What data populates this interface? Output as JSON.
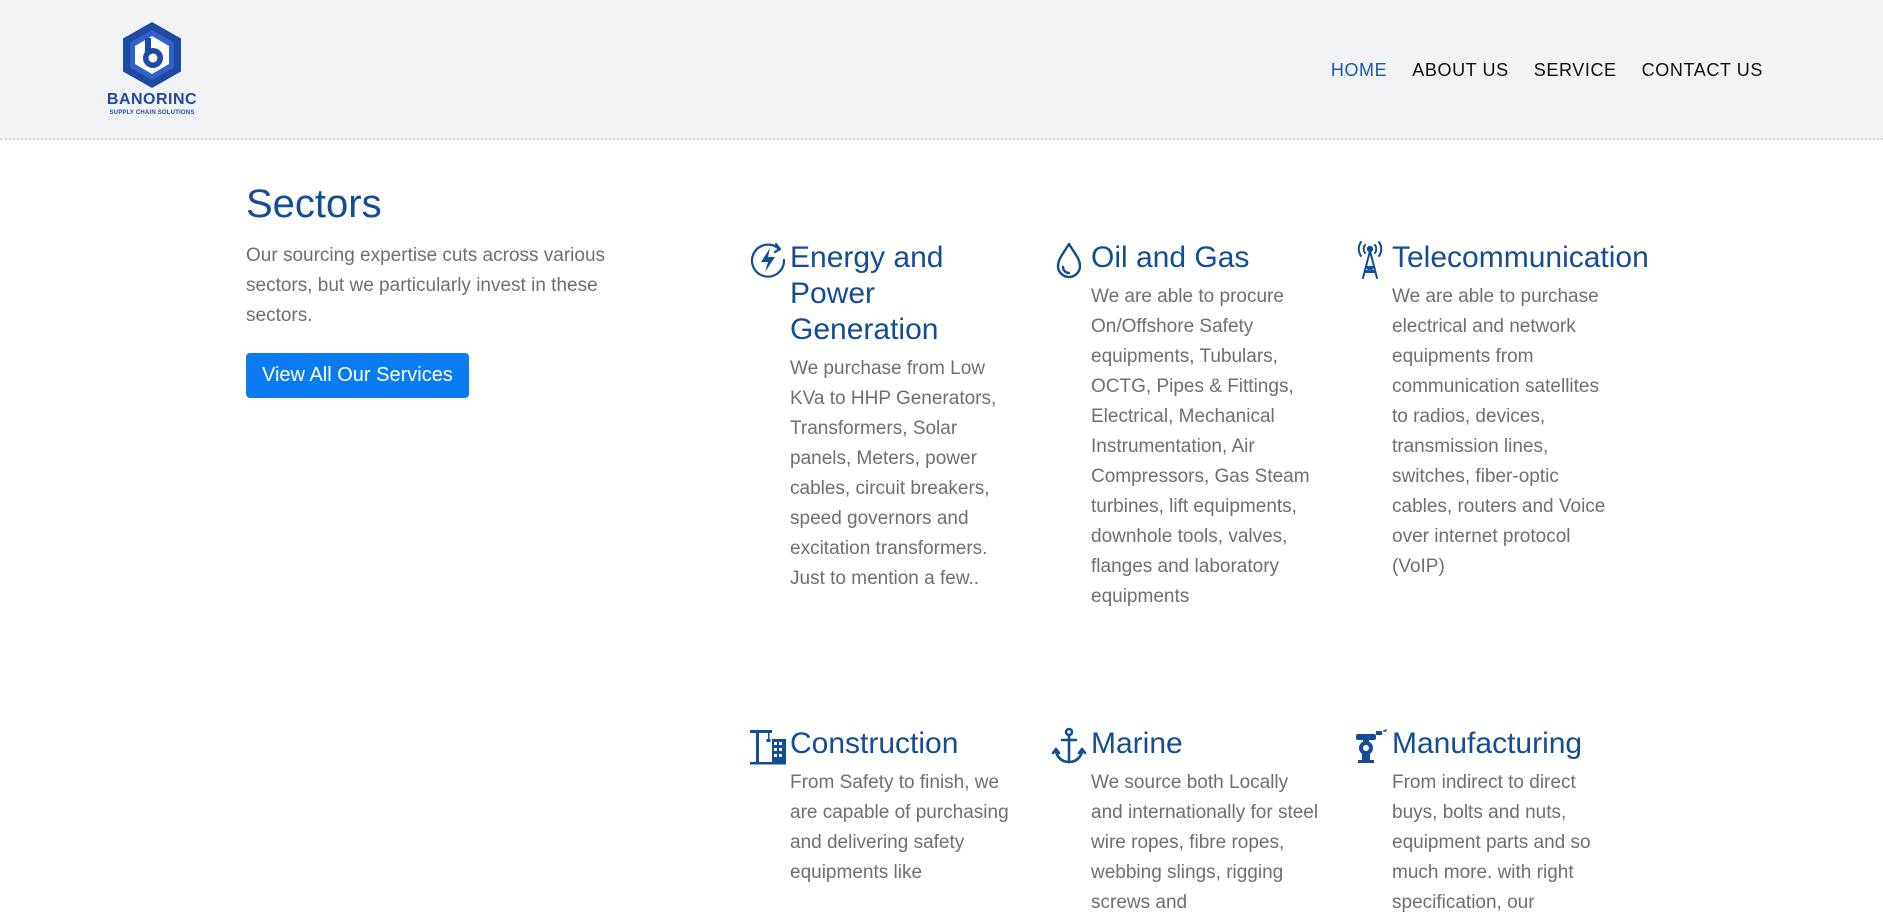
{
  "brand": {
    "name": "BANORINC",
    "tagline": "SUPPLY CHAIN SOLUTIONS"
  },
  "nav": {
    "items": [
      {
        "label": "HOME",
        "active": true
      },
      {
        "label": "ABOUT US",
        "active": false
      },
      {
        "label": "SERVICE",
        "active": false
      },
      {
        "label": "CONTACT US",
        "active": false
      }
    ]
  },
  "intro": {
    "title": "Sectors",
    "text": "Our sourcing expertise cuts across various sectors, but we particularly invest in these sectors.",
    "button_label": "View All Our Services"
  },
  "sectors": [
    {
      "icon": "power-icon",
      "title": "Energy and Power Generation",
      "text": "We purchase from Low KVa to HHP Generators, Transformers, Solar panels, Meters, power cables, circuit breakers, speed governors and excitation transformers. Just to mention a few.."
    },
    {
      "icon": "oil-drop-icon",
      "title": "Oil and Gas",
      "text": "We are able to procure On/Offshore Safety equipments, Tubulars, OCTG, Pipes & Fittings, Electrical, Mechanical Instrumentation, Air Compressors, Gas Steam turbines, lift equipments, downhole tools, valves, flanges and laboratory equipments"
    },
    {
      "icon": "antenna-tower-icon",
      "title": "Telecommunication",
      "text": "We are able to purchase electrical and network equipments from communication satellites to radios, devices, transmission lines, switches, fiber-optic cables, routers and Voice over internet protocol (VoIP)"
    },
    {
      "icon": "crane-icon",
      "title": "Construction",
      "text": "From Safety to finish, we are capable of purchasing and delivering safety equipments like"
    },
    {
      "icon": "anchor-icon",
      "title": "Marine",
      "text": "We source both Locally and internationally for steel wire ropes, fibre ropes, webbing slings, rigging screws and"
    },
    {
      "icon": "robot-arm-icon",
      "title": "Manufacturing",
      "text": "From indirect to direct buys, bolts and nuts, equipment parts and so much more. with right specification, our"
    }
  ],
  "colors": {
    "accent": "#124d96",
    "button": "#0a7cf0",
    "body_text": "#6f6f6f",
    "header_bg": "#f2f3f5"
  }
}
